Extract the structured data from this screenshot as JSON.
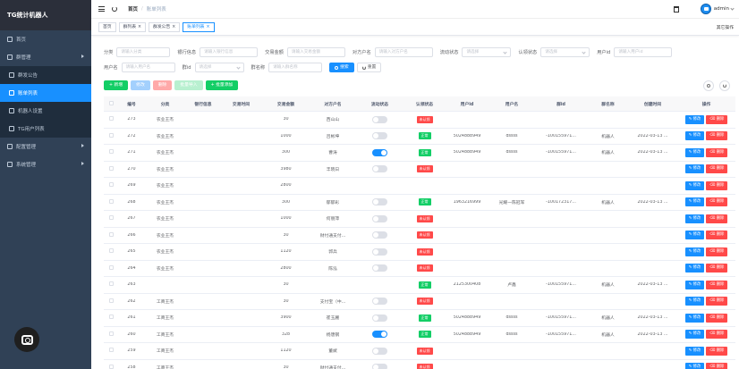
{
  "sidebar": {
    "brand": "TG统计机器人",
    "items": [
      {
        "label": "首页",
        "icon": "home-icon",
        "active": false,
        "sub": false,
        "caret": false
      },
      {
        "label": "群管理",
        "icon": "group-icon",
        "active": false,
        "sub": false,
        "caret": true
      },
      {
        "label": "群发公告",
        "icon": "announce-icon",
        "active": false,
        "sub": true,
        "caret": false
      },
      {
        "label": "账单列表",
        "icon": "bill-icon",
        "active": true,
        "sub": true,
        "caret": false
      },
      {
        "label": "机器人设置",
        "icon": "robot-icon",
        "active": false,
        "sub": true,
        "caret": false
      },
      {
        "label": "TG用户列表",
        "icon": "user-list-icon",
        "active": false,
        "sub": true,
        "caret": false
      },
      {
        "label": "配置管理",
        "icon": "config-icon",
        "active": false,
        "sub": false,
        "caret": true
      },
      {
        "label": "系统管理",
        "icon": "system-icon",
        "active": false,
        "sub": false,
        "caret": true
      }
    ]
  },
  "navbar": {
    "breadcrumb_home": "首页",
    "breadcrumb_sep": "/",
    "breadcrumb_current": "账单列表",
    "user": "admin"
  },
  "tags": {
    "items": [
      {
        "label": "首页",
        "closable": false,
        "active": false
      },
      {
        "label": "群列表",
        "closable": true,
        "active": false
      },
      {
        "label": "群发公告",
        "closable": true,
        "active": false
      },
      {
        "label": "账单列表",
        "closable": true,
        "active": true
      }
    ],
    "right_label": "其它操作"
  },
  "filters": {
    "row1": [
      {
        "label": "分类",
        "placeholder": "请输入分类",
        "select": false,
        "width": 60
      },
      {
        "label": "银行信息",
        "placeholder": "请输入银行信息",
        "select": false,
        "width": 65
      },
      {
        "label": "交易金额",
        "placeholder": "请输入交易金额",
        "select": false,
        "width": 65
      },
      {
        "label": "对方户名",
        "placeholder": "请输入对方户名",
        "select": false,
        "width": 65
      },
      {
        "label": "流动状态",
        "placeholder": "请选择",
        "select": true,
        "width": 55
      },
      {
        "label": "认领状态",
        "placeholder": "请选择",
        "select": true,
        "width": 55
      },
      {
        "label": "用户id",
        "placeholder": "请输入用户id",
        "select": false,
        "width": 65
      }
    ],
    "row2": [
      {
        "label": "用户名",
        "placeholder": "请输入用户名",
        "select": false,
        "width": 60
      },
      {
        "label": "群id",
        "placeholder": "请选择",
        "select": true,
        "width": 55
      },
      {
        "label": "群名称",
        "placeholder": "请输入群名称",
        "select": false,
        "width": 60
      }
    ],
    "search_label": "搜索",
    "reset_label": "重置"
  },
  "toolbar": {
    "add": "+ 新增",
    "edit": "修改",
    "delete": "删除",
    "import": "批量导入",
    "batch_add": "+ 批量添加"
  },
  "table": {
    "headers": [
      "",
      "编号",
      "分类",
      "银行信息",
      "交易时间",
      "交易金额",
      "对方户名",
      "流动状态",
      "认领状态",
      "用户id",
      "用户名",
      "群id",
      "群名称",
      "创建时间",
      "操作"
    ],
    "edit_label": "修改",
    "delete_label": "删除",
    "rows": [
      {
        "no": "273",
        "type": "农业王杰",
        "bank": "",
        "time": "",
        "amt": "30",
        "acct": "西山山",
        "on": false,
        "auth": "未认领",
        "ok": false,
        "uid": "",
        "user": "",
        "gid": "",
        "gname": "",
        "ctime": ""
      },
      {
        "no": "272",
        "type": "农业王杰",
        "bank": "",
        "time": "",
        "amt": "1000",
        "acct": "吕彬坤",
        "on": false,
        "auth": "正常",
        "ok": true,
        "uid": "5024888949",
        "user": "dssss",
        "gid": "-100155971...",
        "gname": "机器人",
        "ctime": "2022-03-13 ..."
      },
      {
        "no": "271",
        "type": "农业王杰",
        "bank": "",
        "time": "",
        "amt": "300",
        "acct": "曹涛",
        "on": true,
        "auth": "正常",
        "ok": true,
        "uid": "5024888949",
        "user": "dssss",
        "gid": "-100155971...",
        "gname": "机器人",
        "ctime": "2022-03-13 ..."
      },
      {
        "no": "270",
        "type": "农业王杰",
        "bank": "",
        "time": "",
        "amt": "3980",
        "acct": "丰晓日",
        "on": false,
        "auth": "未认领",
        "ok": false,
        "uid": "",
        "user": "",
        "gid": "",
        "gname": "",
        "ctime": ""
      },
      {
        "no": "269",
        "type": "农业王杰",
        "bank": "",
        "time": "",
        "amt": "2800",
        "acct": "",
        "on": null,
        "auth": "",
        "ok": false,
        "uid": "",
        "user": "",
        "gid": "",
        "gname": "",
        "ctime": ""
      },
      {
        "no": "268",
        "type": "农业王杰",
        "bank": "",
        "time": "",
        "amt": "300",
        "acct": "郁郁彩",
        "on": false,
        "auth": "正常",
        "ok": true,
        "uid": "1963216999",
        "user": "光耀一陈冠军",
        "gid": "-100172317...",
        "gname": "机器人",
        "ctime": "2022-03-13 ..."
      },
      {
        "no": "267",
        "type": "农业王杰",
        "bank": "",
        "time": "",
        "amt": "1000",
        "acct": "何丽萍",
        "on": false,
        "auth": "未认领",
        "ok": false,
        "uid": "",
        "user": "",
        "gid": "",
        "gname": "",
        "ctime": ""
      },
      {
        "no": "266",
        "type": "农业王杰",
        "bank": "",
        "time": "",
        "amt": "30",
        "acct": "财付通支付...",
        "on": false,
        "auth": "未认领",
        "ok": false,
        "uid": "",
        "user": "",
        "gid": "",
        "gname": "",
        "ctime": ""
      },
      {
        "no": "265",
        "type": "农业王杰",
        "bank": "",
        "time": "",
        "amt": "1120",
        "acct": "郭兵",
        "on": false,
        "auth": "未认领",
        "ok": false,
        "uid": "",
        "user": "",
        "gid": "",
        "gname": "",
        "ctime": ""
      },
      {
        "no": "264",
        "type": "农业王杰",
        "bank": "",
        "time": "",
        "amt": "2800",
        "acct": "陈泓",
        "on": false,
        "auth": "未认领",
        "ok": false,
        "uid": "",
        "user": "",
        "gid": "",
        "gname": "",
        "ctime": ""
      },
      {
        "no": "263",
        "type": "",
        "bank": "",
        "time": "",
        "amt": "30",
        "acct": "",
        "on": null,
        "auth": "正常",
        "ok": true,
        "uid": "2125300408",
        "user": "卢鑫",
        "gid": "-100155971...",
        "gname": "机器人",
        "ctime": "2022-03-13 ..."
      },
      {
        "no": "262",
        "type": "工商王杰",
        "bank": "",
        "time": "",
        "amt": "30",
        "acct": "支付宝（中...",
        "on": false,
        "auth": "未认领",
        "ok": false,
        "uid": "",
        "user": "",
        "gid": "",
        "gname": "",
        "ctime": ""
      },
      {
        "no": "261",
        "type": "工商王杰",
        "bank": "",
        "time": "",
        "amt": "3900",
        "acct": "崔玉麗",
        "on": false,
        "auth": "正常",
        "ok": true,
        "uid": "5024888949",
        "user": "dssss",
        "gid": "-100155971...",
        "gname": "机器人",
        "ctime": "2022-03-13 ..."
      },
      {
        "no": "260",
        "type": "工商王杰",
        "bank": "",
        "time": "",
        "amt": "328",
        "acct": "杨唐钢",
        "on": true,
        "auth": "正常",
        "ok": true,
        "uid": "5024888949",
        "user": "dssss",
        "gid": "-100155971...",
        "gname": "机器人",
        "ctime": "2022-03-13 ..."
      },
      {
        "no": "259",
        "type": "工商王杰",
        "bank": "",
        "time": "",
        "amt": "1120",
        "acct": "董斌",
        "on": false,
        "auth": "未认领",
        "ok": false,
        "uid": "",
        "user": "",
        "gid": "",
        "gname": "",
        "ctime": ""
      },
      {
        "no": "258",
        "type": "工商王杰",
        "bank": "",
        "time": "",
        "amt": "30",
        "acct": "财付通支付...",
        "on": false,
        "auth": "未认领",
        "ok": false,
        "uid": "",
        "user": "",
        "gid": "",
        "gname": "",
        "ctime": ""
      }
    ]
  }
}
